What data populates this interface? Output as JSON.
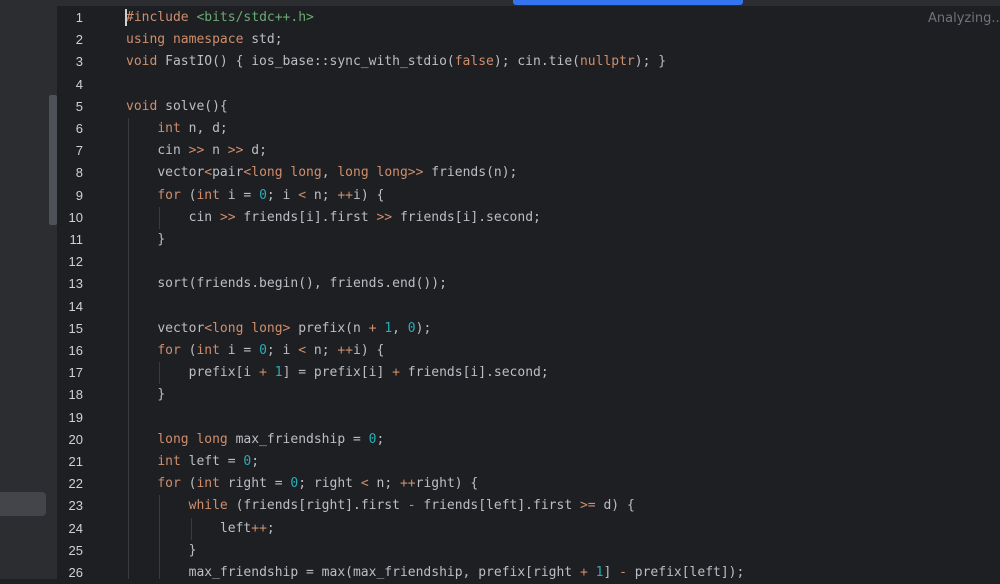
{
  "status_text": "Analyzing...",
  "colors": {
    "background": "#1e1f22",
    "keyword": "#cf8e6d",
    "number": "#2aacb8",
    "include_path": "#6aab73",
    "text": "#bcbec4",
    "progress": "#3574f0"
  },
  "lines": [
    {
      "n": "1",
      "indent": 0,
      "tokens": [
        {
          "t": "#include ",
          "c": "kw"
        },
        {
          "t": "<bits/stdc++.h>",
          "c": "str"
        }
      ]
    },
    {
      "n": "2",
      "indent": 0,
      "tokens": [
        {
          "t": "using namespace ",
          "c": "kw"
        },
        {
          "t": "std;",
          "c": ""
        }
      ]
    },
    {
      "n": "3",
      "indent": 0,
      "tokens": [
        {
          "t": "void ",
          "c": "kw"
        },
        {
          "t": "FastIO() { ios_base::sync_with_stdio(",
          "c": ""
        },
        {
          "t": "false",
          "c": "kw"
        },
        {
          "t": "); cin.tie(",
          "c": ""
        },
        {
          "t": "nullptr",
          "c": "kw"
        },
        {
          "t": "); }",
          "c": ""
        }
      ]
    },
    {
      "n": "4",
      "indent": 0,
      "tokens": []
    },
    {
      "n": "5",
      "indent": 0,
      "tokens": [
        {
          "t": "void ",
          "c": "kw"
        },
        {
          "t": "solve(){",
          "c": ""
        }
      ]
    },
    {
      "n": "6",
      "indent": 1,
      "tokens": [
        {
          "t": "int ",
          "c": "kw"
        },
        {
          "t": "n, d;",
          "c": ""
        }
      ]
    },
    {
      "n": "7",
      "indent": 1,
      "tokens": [
        {
          "t": "cin ",
          "c": ""
        },
        {
          "t": ">>",
          "c": "kw"
        },
        {
          "t": " n ",
          "c": ""
        },
        {
          "t": ">>",
          "c": "kw"
        },
        {
          "t": " d;",
          "c": ""
        }
      ]
    },
    {
      "n": "8",
      "indent": 1,
      "tokens": [
        {
          "t": "vector",
          "c": ""
        },
        {
          "t": "<",
          "c": "kw"
        },
        {
          "t": "pair",
          "c": ""
        },
        {
          "t": "<long long",
          "c": "kw"
        },
        {
          "t": ", ",
          "c": ""
        },
        {
          "t": "long long>>",
          "c": "kw"
        },
        {
          "t": " friends(n);",
          "c": ""
        }
      ]
    },
    {
      "n": "9",
      "indent": 1,
      "tokens": [
        {
          "t": "for ",
          "c": "kw"
        },
        {
          "t": "(",
          "c": ""
        },
        {
          "t": "int ",
          "c": "kw"
        },
        {
          "t": "i = ",
          "c": ""
        },
        {
          "t": "0",
          "c": "num"
        },
        {
          "t": "; i ",
          "c": ""
        },
        {
          "t": "<",
          "c": "kw"
        },
        {
          "t": " n; ",
          "c": ""
        },
        {
          "t": "++",
          "c": "kw"
        },
        {
          "t": "i) {",
          "c": ""
        }
      ]
    },
    {
      "n": "10",
      "indent": 2,
      "tokens": [
        {
          "t": "cin ",
          "c": ""
        },
        {
          "t": ">>",
          "c": "kw"
        },
        {
          "t": " friends[i].first ",
          "c": ""
        },
        {
          "t": ">>",
          "c": "kw"
        },
        {
          "t": " friends[i].second;",
          "c": ""
        }
      ]
    },
    {
      "n": "11",
      "indent": 1,
      "tokens": [
        {
          "t": "}",
          "c": ""
        }
      ]
    },
    {
      "n": "12",
      "indent": 0,
      "tokens": []
    },
    {
      "n": "13",
      "indent": 1,
      "tokens": [
        {
          "t": "sort(friends.begin(), friends.end());",
          "c": ""
        }
      ]
    },
    {
      "n": "14",
      "indent": 0,
      "tokens": []
    },
    {
      "n": "15",
      "indent": 1,
      "tokens": [
        {
          "t": "vector",
          "c": ""
        },
        {
          "t": "<long long>",
          "c": "kw"
        },
        {
          "t": " prefix(n ",
          "c": ""
        },
        {
          "t": "+",
          "c": "kw"
        },
        {
          "t": " ",
          "c": ""
        },
        {
          "t": "1",
          "c": "num"
        },
        {
          "t": ", ",
          "c": ""
        },
        {
          "t": "0",
          "c": "num"
        },
        {
          "t": ");",
          "c": ""
        }
      ]
    },
    {
      "n": "16",
      "indent": 1,
      "tokens": [
        {
          "t": "for ",
          "c": "kw"
        },
        {
          "t": "(",
          "c": ""
        },
        {
          "t": "int ",
          "c": "kw"
        },
        {
          "t": "i = ",
          "c": ""
        },
        {
          "t": "0",
          "c": "num"
        },
        {
          "t": "; i ",
          "c": ""
        },
        {
          "t": "<",
          "c": "kw"
        },
        {
          "t": " n; ",
          "c": ""
        },
        {
          "t": "++",
          "c": "kw"
        },
        {
          "t": "i) {",
          "c": ""
        }
      ]
    },
    {
      "n": "17",
      "indent": 2,
      "tokens": [
        {
          "t": "prefix[i ",
          "c": ""
        },
        {
          "t": "+",
          "c": "kw"
        },
        {
          "t": " ",
          "c": ""
        },
        {
          "t": "1",
          "c": "num"
        },
        {
          "t": "] = prefix[i] ",
          "c": ""
        },
        {
          "t": "+",
          "c": "kw"
        },
        {
          "t": " friends[i].second;",
          "c": ""
        }
      ]
    },
    {
      "n": "18",
      "indent": 1,
      "tokens": [
        {
          "t": "}",
          "c": ""
        }
      ]
    },
    {
      "n": "19",
      "indent": 0,
      "tokens": []
    },
    {
      "n": "20",
      "indent": 1,
      "tokens": [
        {
          "t": "long long ",
          "c": "kw"
        },
        {
          "t": "max_friendship = ",
          "c": ""
        },
        {
          "t": "0",
          "c": "num"
        },
        {
          "t": ";",
          "c": ""
        }
      ]
    },
    {
      "n": "21",
      "indent": 1,
      "tokens": [
        {
          "t": "int ",
          "c": "kw"
        },
        {
          "t": "left = ",
          "c": ""
        },
        {
          "t": "0",
          "c": "num"
        },
        {
          "t": ";",
          "c": ""
        }
      ]
    },
    {
      "n": "22",
      "indent": 1,
      "tokens": [
        {
          "t": "for ",
          "c": "kw"
        },
        {
          "t": "(",
          "c": ""
        },
        {
          "t": "int ",
          "c": "kw"
        },
        {
          "t": "right = ",
          "c": ""
        },
        {
          "t": "0",
          "c": "num"
        },
        {
          "t": "; right ",
          "c": ""
        },
        {
          "t": "<",
          "c": "kw"
        },
        {
          "t": " n; ",
          "c": ""
        },
        {
          "t": "++",
          "c": "kw"
        },
        {
          "t": "right) {",
          "c": ""
        }
      ]
    },
    {
      "n": "23",
      "indent": 2,
      "tokens": [
        {
          "t": "while ",
          "c": "kw"
        },
        {
          "t": "(friends[right].first ",
          "c": ""
        },
        {
          "t": "-",
          "c": "kw"
        },
        {
          "t": " friends[left].first ",
          "c": ""
        },
        {
          "t": ">=",
          "c": "kw"
        },
        {
          "t": " d) {",
          "c": ""
        }
      ]
    },
    {
      "n": "24",
      "indent": 3,
      "tokens": [
        {
          "t": "left",
          "c": ""
        },
        {
          "t": "++",
          "c": "kw"
        },
        {
          "t": ";",
          "c": ""
        }
      ]
    },
    {
      "n": "25",
      "indent": 2,
      "tokens": [
        {
          "t": "}",
          "c": ""
        }
      ]
    },
    {
      "n": "26",
      "indent": 2,
      "tokens": [
        {
          "t": "max_friendship = max(max_friendship, prefix[right ",
          "c": ""
        },
        {
          "t": "+",
          "c": "kw"
        },
        {
          "t": " ",
          "c": ""
        },
        {
          "t": "1",
          "c": "num"
        },
        {
          "t": "] ",
          "c": ""
        },
        {
          "t": "-",
          "c": "kw"
        },
        {
          "t": " prefix[left]);",
          "c": ""
        }
      ]
    }
  ]
}
